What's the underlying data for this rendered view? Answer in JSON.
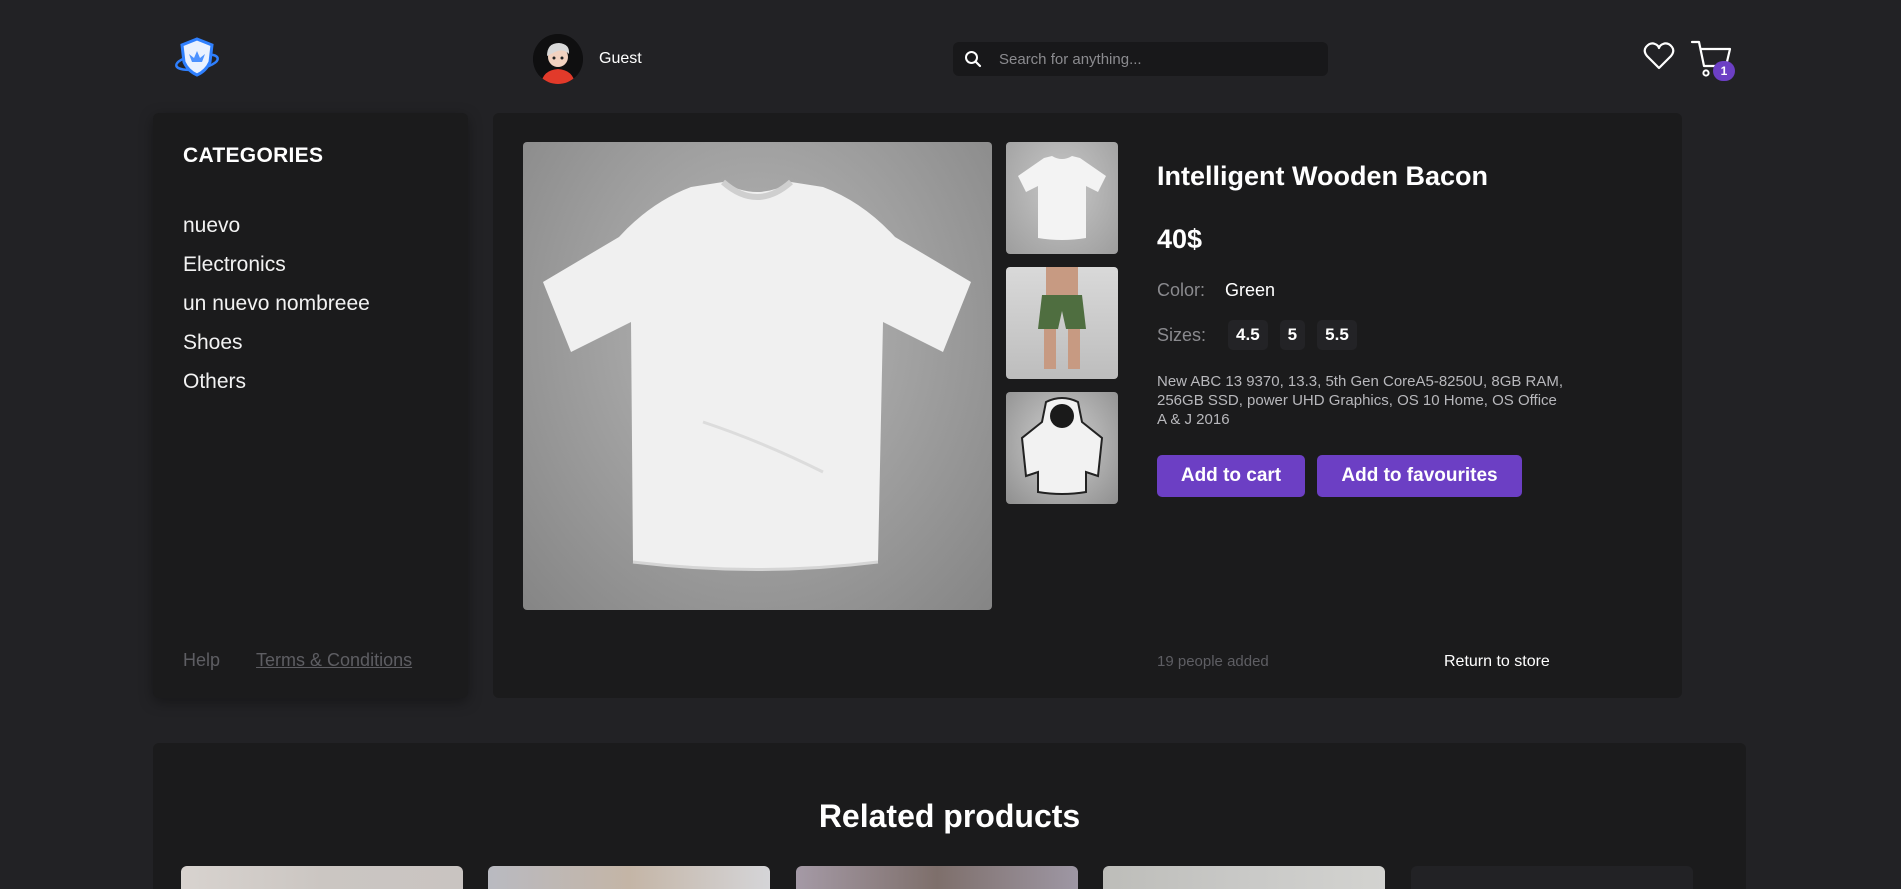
{
  "header": {
    "logo_icon": "shield-logo-icon",
    "user_name": "Guest",
    "search_placeholder": "Search for anything...",
    "cart_count": "1"
  },
  "sidebar": {
    "title": "CATEGORIES",
    "categories": [
      "nuevo",
      "Electronics",
      "un nuevo nombreee",
      "Shoes",
      "Others"
    ],
    "help_label": "Help",
    "terms_label": "Terms & Conditions"
  },
  "product": {
    "title": "Intelligent Wooden Bacon",
    "price": "40$",
    "color_label": "Color:",
    "color_value": "Green",
    "sizes_label": "Sizes:",
    "sizes": [
      "4.5",
      "5",
      "5.5"
    ],
    "description": "New ABC 13 9370, 13.3, 5th Gen CoreA5-8250U, 8GB RAM, 256GB SSD, power UHD Graphics, OS 10 Home, OS Office A & J 2016",
    "add_to_cart_label": "Add to cart",
    "add_to_favourites_label": "Add to favourites",
    "people_added": "19 people added",
    "return_label": "Return to store"
  },
  "related": {
    "title": "Related products"
  },
  "colors": {
    "accent": "#6c3fc4",
    "background": "#222225",
    "panel": "#1b1b1c"
  }
}
